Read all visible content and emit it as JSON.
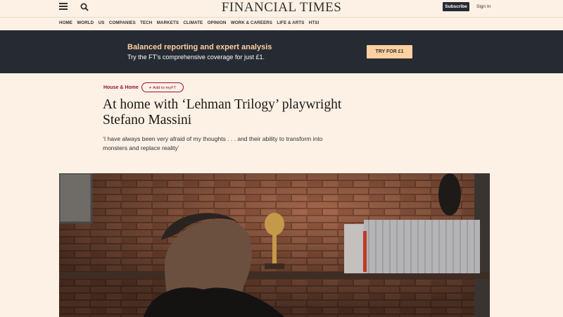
{
  "header": {
    "logo": "FINANCIAL TIMES",
    "subscribe_label": "Subscribe",
    "signin_label": "Sign In"
  },
  "nav": {
    "items": [
      "HOME",
      "WORLD",
      "US",
      "COMPANIES",
      "TECH",
      "MARKETS",
      "CLIMATE",
      "OPINION",
      "WORK & CAREERS",
      "LIFE & ARTS",
      "HTSI"
    ]
  },
  "promo": {
    "title": "Balanced reporting and expert analysis",
    "subtitle": "Try the FT's comprehensive coverage for just £1.",
    "cta_label": "TRY FOR £1"
  },
  "article": {
    "section": "House & Home",
    "myft_label": "Add to myFT",
    "headline": "At home with ‘Lehman Trilogy’ playwright Stefano Massini",
    "standfirst": "‘I have always been very afraid of my thoughts . . . and their ability to transform into monsters and replace reality’"
  },
  "colors": {
    "background": "#fdf1e5",
    "banner": "#262a33",
    "banner_title": "#fcd0a1",
    "accent": "#990f3d"
  },
  "icons": {
    "menu": "menu-icon",
    "search": "search-icon",
    "plus": "plus-icon"
  }
}
